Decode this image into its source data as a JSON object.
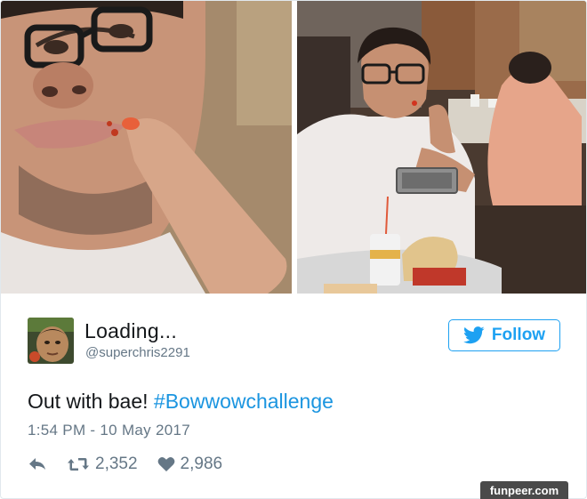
{
  "tweet": {
    "display_name": "Loading...",
    "handle": "@superchris2291",
    "text_plain": "Out with bae! ",
    "hashtag": "#Bowwowchallenge",
    "timestamp": "1:54 PM - 10 May 2017",
    "retweet_count": "2,352",
    "like_count": "2,986"
  },
  "follow_button": {
    "label": "Follow",
    "icon": "twitter-bird-icon"
  },
  "actions": {
    "reply_icon": "reply-icon",
    "retweet_icon": "retweet-icon",
    "like_icon": "heart-icon"
  },
  "watermark": {
    "text": "funpeer.com"
  },
  "colors": {
    "brand": "#1da1f2",
    "hashtag": "#1b95e0",
    "secondary_text": "#657786",
    "primary_text": "#14171a",
    "border": "#e1e8ed",
    "watermark_bg": "#4a4a4a"
  }
}
